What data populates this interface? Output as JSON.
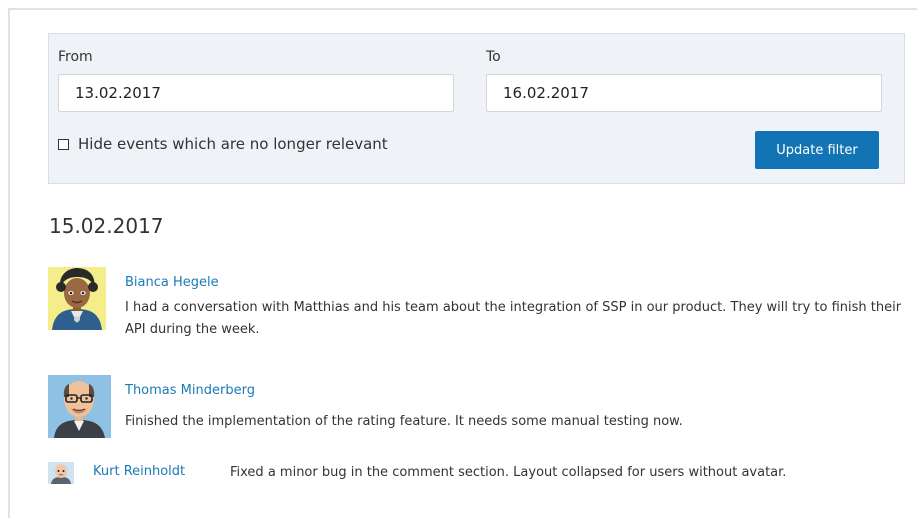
{
  "filter": {
    "from_label": "From",
    "from_value": "13.02.2017",
    "to_label": "To",
    "to_value": "16.02.2017",
    "hide_label": "Hide events which are no longer relevant",
    "hide_checked": false,
    "update_label": "Update filter"
  },
  "date_heading": "15.02.2017",
  "events": [
    {
      "author": "Bianca Hegele",
      "text": "I had a conversation with Matthias and his team about the integration of SSP in our product. They will try to finish their API during the week.",
      "avatar": "avatar-bianca-icon"
    },
    {
      "author": "Thomas Minderberg",
      "text": "Finished the implementation of the rating feature. It needs some manual testing now.",
      "avatar": "avatar-thomas-icon"
    },
    {
      "author": "Kurt Reinholdt",
      "text": "Fixed a minor bug in the comment section. Layout collapsed for users without avatar.",
      "avatar": "avatar-kurt-icon"
    }
  ],
  "colors": {
    "accent": "#1374b5",
    "link": "#1a7ab8",
    "panel_bg": "#eff3f7"
  }
}
